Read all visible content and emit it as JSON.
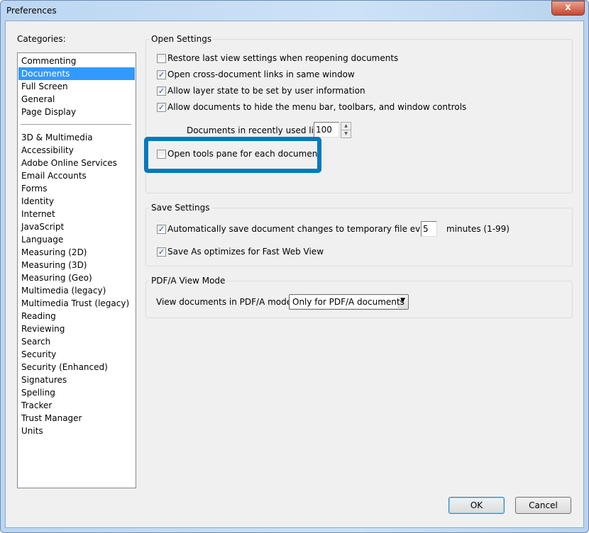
{
  "window": {
    "title": "Preferences",
    "close": "x"
  },
  "categories": {
    "label": "Categories:",
    "group1": [
      "Commenting",
      "Documents",
      "Full Screen",
      "General",
      "Page Display"
    ],
    "selected": "Documents",
    "group2": [
      "3D & Multimedia",
      "Accessibility",
      "Adobe Online Services",
      "Email Accounts",
      "Forms",
      "Identity",
      "Internet",
      "JavaScript",
      "Language",
      "Measuring (2D)",
      "Measuring (3D)",
      "Measuring (Geo)",
      "Multimedia (legacy)",
      "Multimedia Trust (legacy)",
      "Reading",
      "Reviewing",
      "Search",
      "Security",
      "Security (Enhanced)",
      "Signatures",
      "Spelling",
      "Tracker",
      "Trust Manager",
      "Units"
    ]
  },
  "open_settings": {
    "label": "Open Settings",
    "options": [
      {
        "label": "Restore last view settings when reopening documents",
        "checked": false
      },
      {
        "label": "Open cross-document links in same window",
        "checked": true
      },
      {
        "label": "Allow layer state to be set by user information",
        "checked": true
      },
      {
        "label": "Allow documents to hide the menu bar, toolbars, and window controls",
        "checked": true
      }
    ],
    "recent_label": "Documents in recently used list:",
    "recent_value": "100",
    "tools_pane": {
      "label": "Open tools pane for each document",
      "checked": false
    }
  },
  "save_settings": {
    "label": "Save Settings",
    "autosave_label": "Automatically save document changes to temporary file every:",
    "autosave_checked": true,
    "autosave_value": "5",
    "autosave_unit": "minutes (1-99)",
    "fastweb_label": "Save As optimizes for Fast Web View",
    "fastweb_checked": true
  },
  "pdfa": {
    "label": "PDF/A View Mode",
    "mode_label": "View documents in PDF/A mode:",
    "mode_value": "Only for PDF/A documents"
  },
  "buttons": {
    "ok": "OK",
    "cancel": "Cancel"
  },
  "highlight_color": "#0079c1"
}
